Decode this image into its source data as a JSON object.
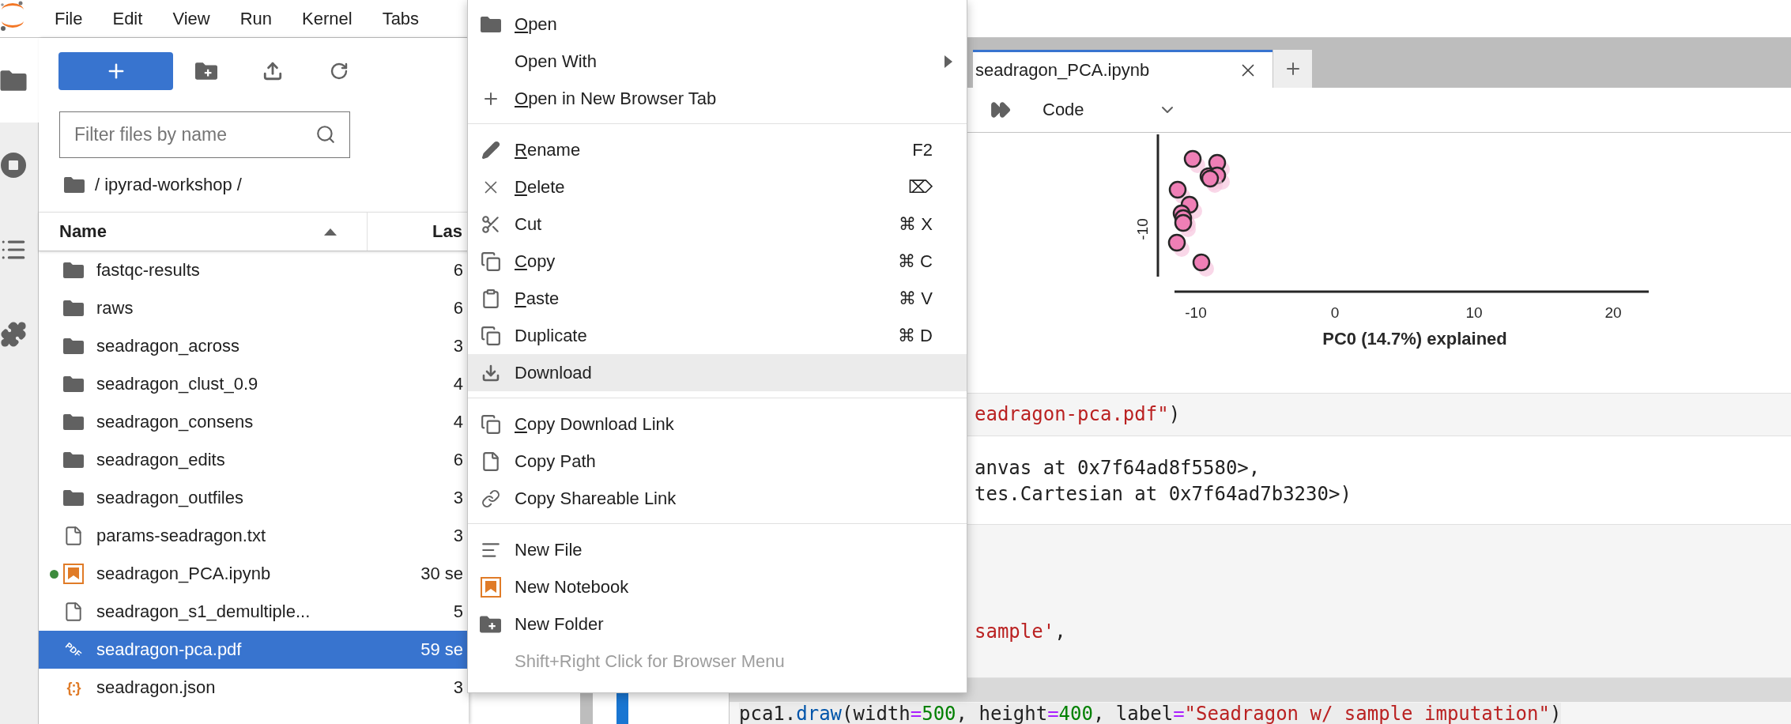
{
  "menu_bar": {
    "items": [
      "File",
      "Edit",
      "View",
      "Run",
      "Kernel",
      "Tabs"
    ]
  },
  "activity_bar": [
    {
      "selected": true
    },
    {
      "selected": false
    },
    {
      "selected": false
    },
    {
      "selected": false
    }
  ],
  "file_browser": {
    "filter": {
      "placeholder": "Filter files by name"
    },
    "breadcrumb": "/ ipyrad-workshop /",
    "columns": [
      {
        "label": "Name",
        "sort_ascending": true
      },
      {
        "label": "Las"
      }
    ],
    "rows": [
      {
        "name": "fastqc-results",
        "modified": "6",
        "kind": "folder",
        "running": false,
        "selected": false
      },
      {
        "name": "raws",
        "modified": "6",
        "kind": "folder",
        "running": false,
        "selected": false
      },
      {
        "name": "seadragon_across",
        "modified": "3",
        "kind": "folder",
        "running": false,
        "selected": false
      },
      {
        "name": "seadragon_clust_0.9",
        "modified": "4",
        "kind": "folder",
        "running": false,
        "selected": false
      },
      {
        "name": "seadragon_consens",
        "modified": "4",
        "kind": "folder",
        "running": false,
        "selected": false
      },
      {
        "name": "seadragon_edits",
        "modified": "6",
        "kind": "folder",
        "running": false,
        "selected": false
      },
      {
        "name": "seadragon_outfiles",
        "modified": "3",
        "kind": "folder",
        "running": false,
        "selected": false
      },
      {
        "name": "params-seadragon.txt",
        "modified": "3",
        "kind": "file",
        "running": false,
        "selected": false
      },
      {
        "name": "seadragon_PCA.ipynb",
        "modified": "30 se",
        "kind": "notebook",
        "running": true,
        "selected": false
      },
      {
        "name": "seadragon_s1_demultiple...",
        "modified": "5",
        "kind": "file",
        "running": false,
        "selected": false
      },
      {
        "name": "seadragon-pca.pdf",
        "modified": "59 se",
        "kind": "pdf",
        "icon_label": "PDF",
        "running": false,
        "selected": true
      },
      {
        "name": "seadragon.json",
        "modified": "3",
        "kind": "json",
        "icon_label": "{:}",
        "running": false,
        "selected": false
      }
    ]
  },
  "notebook": {
    "tabs": [
      {
        "label": "seadragon_PCA.ipynb",
        "selected": true
      }
    ],
    "toolbar": {
      "cell_type": "Code"
    },
    "plot": {
      "x_ticks": [
        "-10",
        "0",
        "10",
        "20"
      ],
      "y_ticks": [
        "-10"
      ],
      "x_title": "PC0 (14.7%) explained"
    },
    "cells": [
      {
        "kind": "input",
        "lines": [
          [
            {
              "text": "eadragon-pca.pdf\"",
              "kind": "string"
            },
            {
              "text": ")",
              "kind": "plain"
            }
          ]
        ]
      },
      {
        "kind": "output",
        "lines": [
          [
            {
              "text": "anvas at 0x7f64ad8f5580>,",
              "kind": "plain"
            }
          ],
          [
            {
              "text": "tes.Cartesian at 0x7f64ad7b3230>)",
              "kind": "plain"
            }
          ]
        ]
      },
      {
        "kind": "input",
        "lines": [
          [
            {
              "text": "sample'",
              "kind": "string"
            },
            {
              "text": ",",
              "kind": "plain"
            }
          ]
        ]
      },
      {
        "kind": "input",
        "active": true,
        "lines": [
          [
            {
              "text": "pca1.",
              "kind": "plain"
            },
            {
              "text": "draw",
              "kind": "property"
            },
            {
              "text": "(width",
              "kind": "plain"
            },
            {
              "text": "=",
              "kind": "operator"
            },
            {
              "text": "500",
              "kind": "number"
            },
            {
              "text": ", height",
              "kind": "plain"
            },
            {
              "text": "=",
              "kind": "operator"
            },
            {
              "text": "400",
              "kind": "number"
            },
            {
              "text": ", label",
              "kind": "plain"
            },
            {
              "text": "=",
              "kind": "operator"
            },
            {
              "text": "\"Seadragon w/ sample imputation\"",
              "kind": "string"
            },
            {
              "text": ")",
              "kind": "plain"
            }
          ]
        ]
      }
    ]
  },
  "context_menu": {
    "sections": [
      [
        {
          "label": "Open",
          "underline_first": true,
          "submenu": false,
          "selected": false,
          "disabled": false
        },
        {
          "label": "Open With",
          "underline_first": false,
          "submenu": true,
          "selected": false,
          "disabled": false
        },
        {
          "label": "Open in New Browser Tab",
          "underline_first": true,
          "submenu": false,
          "selected": false,
          "disabled": false
        }
      ],
      [
        {
          "label": "Rename",
          "shortcut": "F2",
          "underline_first": true,
          "submenu": false,
          "selected": false,
          "disabled": false
        },
        {
          "label": "Delete",
          "shortcut": "⌦",
          "underline_first": true,
          "submenu": false,
          "selected": false,
          "disabled": false
        },
        {
          "label": "Cut",
          "shortcut": "⌘ X",
          "underline_first": false,
          "submenu": false,
          "selected": false,
          "disabled": false
        },
        {
          "label": "Copy",
          "shortcut": "⌘ C",
          "underline_first": true,
          "submenu": false,
          "selected": false,
          "disabled": false
        },
        {
          "label": "Paste",
          "shortcut": "⌘ V",
          "underline_first": true,
          "submenu": false,
          "selected": false,
          "disabled": false
        },
        {
          "label": "Duplicate",
          "shortcut": "⌘ D",
          "underline_first": false,
          "submenu": false,
          "selected": false,
          "disabled": false
        },
        {
          "label": "Download",
          "underline_first": false,
          "submenu": false,
          "selected": true,
          "disabled": false
        }
      ],
      [
        {
          "label": "Copy Download Link",
          "underline_first": true,
          "submenu": false,
          "selected": false,
          "disabled": false
        },
        {
          "label": "Copy Path",
          "underline_first": false,
          "submenu": false,
          "selected": false,
          "disabled": false
        },
        {
          "label": "Copy Shareable Link",
          "underline_first": false,
          "submenu": false,
          "selected": false,
          "disabled": false
        }
      ],
      [
        {
          "label": "New File",
          "underline_first": false,
          "submenu": false,
          "selected": false,
          "disabled": false
        },
        {
          "label": "New Notebook",
          "underline_first": false,
          "submenu": false,
          "selected": false,
          "disabled": false
        },
        {
          "label": "New Folder",
          "underline_first": false,
          "submenu": false,
          "selected": false,
          "disabled": false
        },
        {
          "label": "Shift+Right Click for Browser Menu",
          "underline_first": false,
          "submenu": false,
          "selected": false,
          "disabled": true
        }
      ]
    ]
  }
}
